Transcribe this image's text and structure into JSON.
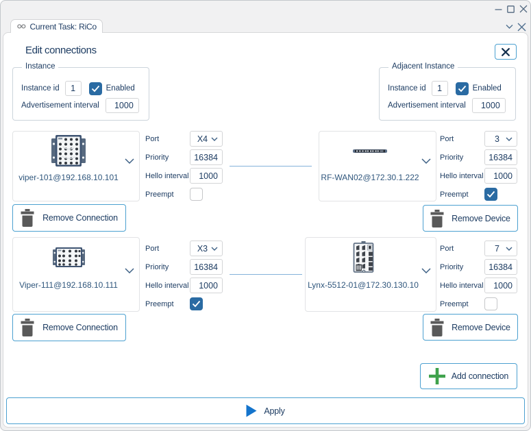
{
  "window": {
    "controls": {
      "minimize": "minimize",
      "maximize": "maximize",
      "close": "close"
    }
  },
  "tab": {
    "label": "Current Task: RiCo"
  },
  "panel": {
    "title": "Edit connections"
  },
  "instance_group": {
    "legend": "Instance",
    "instance_id_label": "Instance id",
    "instance_id_value": "1",
    "enabled_label": "Enabled",
    "enabled_checked": true,
    "advertisement_label": "Advertisement interval",
    "advertisement_value": "1000"
  },
  "adjacent_group": {
    "legend": "Adjacent Instance",
    "instance_id_label": "Instance id",
    "instance_id_value": "1",
    "enabled_label": "Enabled",
    "enabled_checked": true,
    "advertisement_label": "Advertisement interval",
    "advertisement_value": "1000"
  },
  "fields": {
    "port": "Port",
    "priority": "Priority",
    "hello": "Hello interval",
    "preempt": "Preempt"
  },
  "rows": [
    {
      "left": {
        "name": "viper-101@192.168.10.101",
        "port": "X4",
        "priority": "16384",
        "hello": "1000",
        "preempt": false
      },
      "right": {
        "name": "RF-WAN02@172.30.1.222",
        "port": "3",
        "priority": "16384",
        "hello": "1000",
        "preempt": true
      }
    },
    {
      "left": {
        "name": "Viper-111@192.168.10.111",
        "port": "X3",
        "priority": "16384",
        "hello": "1000",
        "preempt": true
      },
      "right": {
        "name": "Lynx-5512-01@172.30.130.10",
        "port": "7",
        "priority": "16384",
        "hello": "1000",
        "preempt": false
      }
    }
  ],
  "buttons": {
    "remove_connection": "Remove Connection",
    "remove_device": "Remove Device",
    "add_connection": "Add connection",
    "apply": "Apply"
  },
  "colors": {
    "accent_blue_border": "#4ba0d0",
    "navy_text": "#1d3c62",
    "checkbox_blue": "#2a6ba3",
    "green_plus": "#3fa24c",
    "apply_triangle": "#1474cc",
    "trash_gray": "#595959",
    "connection_line": "#83b2da"
  }
}
